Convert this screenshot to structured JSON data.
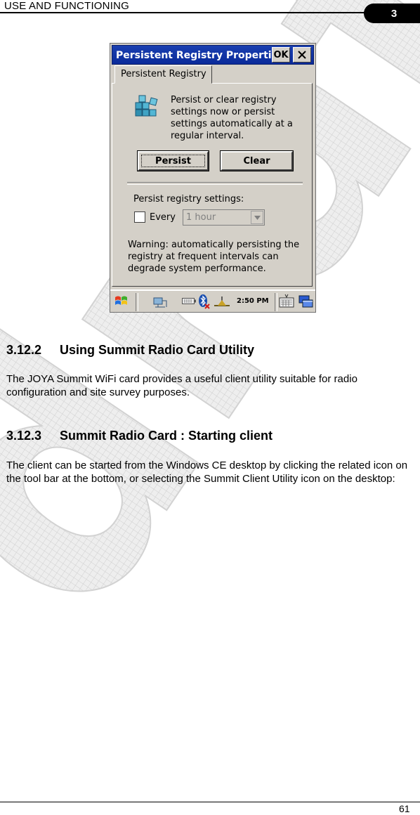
{
  "header": {
    "title": "USE AND FUNCTIONING",
    "chapter": "3"
  },
  "dialog": {
    "title": "Persistent Registry Properties",
    "ok_label": "OK",
    "tab_label": "Persistent Registry",
    "intro_text": "Persist or clear registry settings now or persist settings automatically at a regular interval.",
    "persist_button": "Persist",
    "clear_button": "Clear",
    "settings_label": "Persist registry settings:",
    "every_label": "Every",
    "interval_value": "1 hour",
    "warning_text": "Warning: automatically persisting the registry at frequent intervals can degrade system performance.",
    "taskbar_time": "2:50 PM"
  },
  "sections": [
    {
      "number": "3.12.2",
      "title": "Using Summit Radio Card Utility",
      "text": "The JOYA Summit WiFi card provides a useful client utility suitable for radio configuration and site survey purposes."
    },
    {
      "number": "3.12.3",
      "title": "Summit Radio Card : Starting client",
      "text": "The client can be started from the Windows CE desktop by clicking the related icon on the tool bar at the bottom, or selecting the Summit Client Utility icon on the desktop:"
    }
  ],
  "watermark": "draft",
  "footer": {
    "page_number": "61"
  },
  "colors": {
    "titlebar": "#0a2a9a",
    "dialog_face": "#d4d0c8",
    "watermark": "#dcdcdc"
  }
}
